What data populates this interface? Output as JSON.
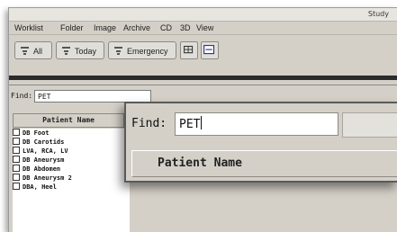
{
  "window": {
    "title": "Study"
  },
  "menu": {
    "items": [
      "Worklist",
      "Folder",
      "Image",
      "Archive",
      "CD",
      "3D",
      "View"
    ]
  },
  "toolbar": {
    "buttons": [
      {
        "label": "All",
        "icon": "list-icon"
      },
      {
        "label": "Today",
        "icon": "list-icon"
      },
      {
        "label": "Emergency",
        "icon": "list-icon"
      }
    ],
    "icon_buttons": [
      "grid-view-icon",
      "list-view-icon"
    ]
  },
  "search": {
    "label": "Find:",
    "value": "PET"
  },
  "patient_list": {
    "header": "Patient Name",
    "items": [
      "DB Foot",
      "DB Carotids",
      "LVA, RCA, LV",
      "DB Aneurysm",
      "DB Abdomen",
      "DB Aneurysm 2",
      "DBA, Heel"
    ]
  },
  "zoom_callout": {
    "search": {
      "label": "Find:",
      "value": "PET"
    },
    "header": "Patient Name"
  },
  "colors": {
    "window_bg": "#d4d0c8",
    "input_bg": "#ffffff",
    "text": "#111111"
  }
}
